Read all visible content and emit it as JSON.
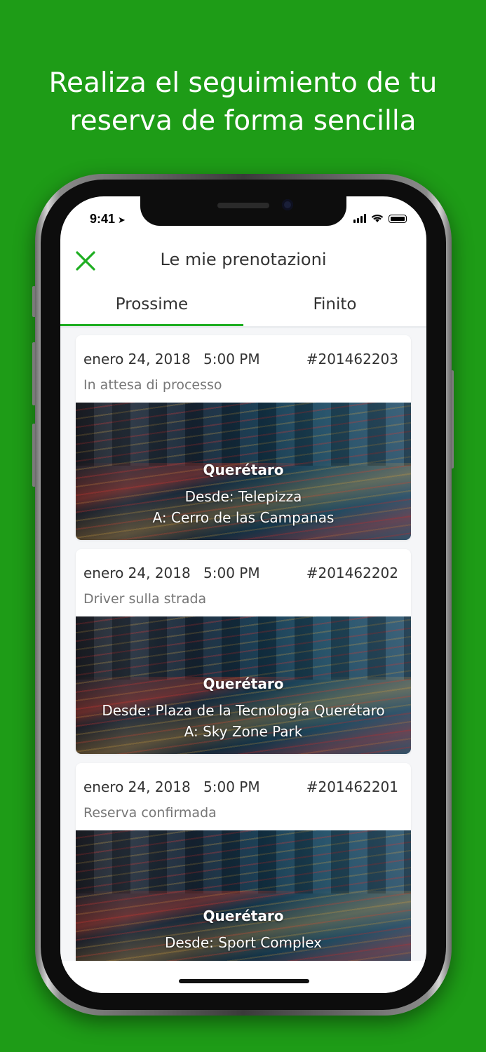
{
  "headline": {
    "line1": "Realiza el seguimiento de tu",
    "line2": "reserva de forma sencilla"
  },
  "status_bar": {
    "time": "9:41",
    "location_icon": "navigation-arrow-icon"
  },
  "app_bar": {
    "title": "Le mie prenotazioni",
    "close_icon": "close-icon",
    "accent_color": "#1fae22"
  },
  "tabs": [
    {
      "label": "Prossime",
      "active": true
    },
    {
      "label": "Finito",
      "active": false
    }
  ],
  "bookings": [
    {
      "date": "enero 24, 2018",
      "time": "5:00 PM",
      "id": "#201462203",
      "status": "In attesa di processo",
      "city": "Querétaro",
      "from": "Desde: Telepizza",
      "to": "A: Cerro de las Campanas"
    },
    {
      "date": "enero 24, 2018",
      "time": "5:00 PM",
      "id": "#201462202",
      "status": "Driver sulla strada",
      "city": "Querétaro",
      "from": "Desde:  Plaza de la Tecnología Querétaro",
      "to": "A: Sky Zone Park"
    },
    {
      "date": "enero 24, 2018",
      "time": "5:00 PM",
      "id": "#201462201",
      "status": "Reserva confirmada",
      "city": "Querétaro",
      "from": "Desde:  Sport Complex"
    }
  ]
}
